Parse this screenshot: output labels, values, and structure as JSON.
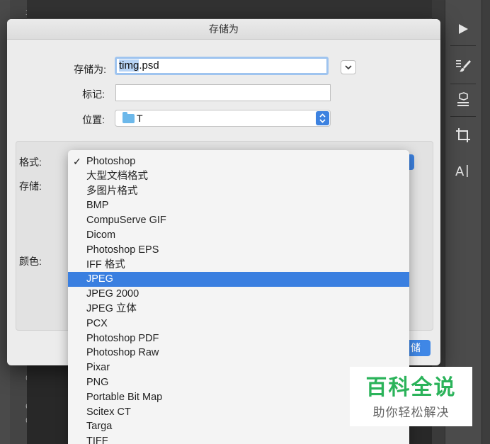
{
  "app": {
    "ruler_marks": [
      "3",
      "0",
      "6",
      "0"
    ],
    "tools": [
      "play-icon",
      "brush-settings-icon",
      "3d-icon",
      "crop-icon",
      "type-icon"
    ]
  },
  "dialog": {
    "title": "存储为",
    "save_as_label": "存储为:",
    "filename": {
      "selected": "timg",
      "rest": ".psd"
    },
    "tags_label": "标记:",
    "tags_value": "",
    "location_label": "位置:",
    "location_value": "T",
    "format_label": "格式:",
    "save_label": "存储:",
    "color_label": "颜色:",
    "save_button_partial": "储"
  },
  "format_menu": {
    "items": [
      "Photoshop",
      "大型文档格式",
      "多图片格式",
      "BMP",
      "CompuServe GIF",
      "Dicom",
      "Photoshop EPS",
      "IFF 格式",
      "JPEG",
      "JPEG 2000",
      "JPEG 立体",
      "PCX",
      "Photoshop PDF",
      "Photoshop Raw",
      "Pixar",
      "PNG",
      "Portable Bit Map",
      "Scitex CT",
      "Targa",
      "TIFF"
    ],
    "checked_item": "Photoshop",
    "highlighted_item": "JPEG"
  },
  "watermark": {
    "brand": "百科全说",
    "slogan": "助你轻松解决"
  },
  "colors": {
    "accent": "#3a7fe0",
    "dialog_bg": "#ececec",
    "watermark_green": "#2bb35a"
  }
}
